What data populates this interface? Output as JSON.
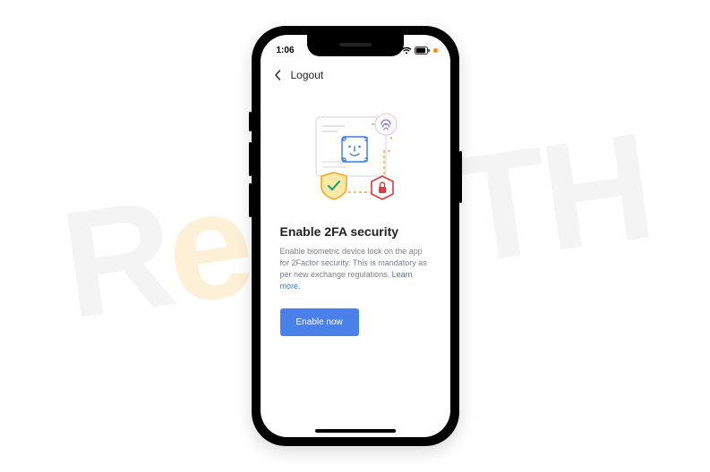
{
  "status": {
    "time": "1:06",
    "signal_icon": "cellular-signal-icon",
    "wifi_icon": "wifi-icon",
    "battery_icon": "battery-icon"
  },
  "nav": {
    "back_icon": "chevron-left-icon",
    "title": "Logout"
  },
  "illustration": {
    "fingerprint_icon": "fingerprint-icon",
    "faceid_icon": "face-id-icon",
    "shield_icon": "shield-check-icon",
    "lock_icon": "lock-icon"
  },
  "content": {
    "heading": "Enable 2FA security",
    "description": "Enable biometric device lock on the app for 2Factor security. This is mandatory as per new exchange regulations.",
    "learn_more": "Learn more."
  },
  "cta": {
    "label": "Enable now"
  },
  "colors": {
    "primary_button": "#4a80ea",
    "link": "#3b73d9",
    "text": "#222222",
    "muted": "#7a7f87",
    "shield_orange": "#f5a623",
    "shield_green": "#1aa86b",
    "lock_red": "#e13a3a",
    "faceid_blue": "#3a7de0",
    "fingerprint_purple": "#7c5bd6"
  }
}
